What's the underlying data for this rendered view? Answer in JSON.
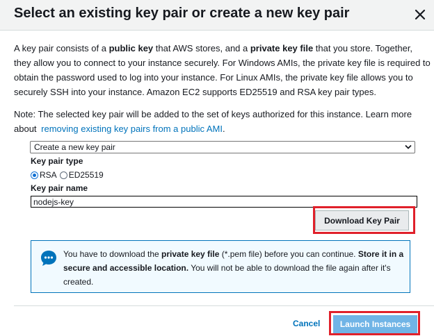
{
  "dialog": {
    "title": "Select an existing key pair or create a new key pair",
    "close_glyph": "✕"
  },
  "intro": {
    "t1": "A key pair consists of a ",
    "b1": "public key",
    "t2": " that AWS stores, and a ",
    "b2": "private key file",
    "t3": " that you store. Together, they allow you to connect to your instance securely. For Windows AMIs, the private key file is required to obtain the password used to log into your instance. For Linux AMIs, the private key file allows you to securely SSH into your instance. Amazon EC2 supports ED25519 and RSA key pair types."
  },
  "note": {
    "text": "Note: The selected key pair will be added to the set of keys authorized for this instance. Learn more about",
    "link": "removing existing key pairs from a public AMI",
    "end": "."
  },
  "key_pair_select": {
    "selected": "Create a new key pair"
  },
  "key_pair_type": {
    "label": "Key pair type",
    "options": [
      {
        "label": "RSA",
        "checked": true
      },
      {
        "label": "ED25519",
        "checked": false
      }
    ]
  },
  "key_pair_name": {
    "label": "Key pair name",
    "value": "nodejs-key"
  },
  "download_button": {
    "label": "Download Key Pair"
  },
  "info": {
    "t1": "You have to download the ",
    "b1": "private key file",
    "t2": " (*.pem file) before you can continue. ",
    "b2": "Store it in a secure and accessible location.",
    "t3": " You will not be able to download the file again after it's created."
  },
  "footer": {
    "cancel_label": "Cancel",
    "launch_label": "Launch Instances"
  },
  "colors": {
    "link": "#0073bb",
    "highlight": "#e0202a",
    "primary_disabled": "#70b4e6",
    "info_bg": "#f1faff",
    "info_icon": "#0073bb"
  }
}
